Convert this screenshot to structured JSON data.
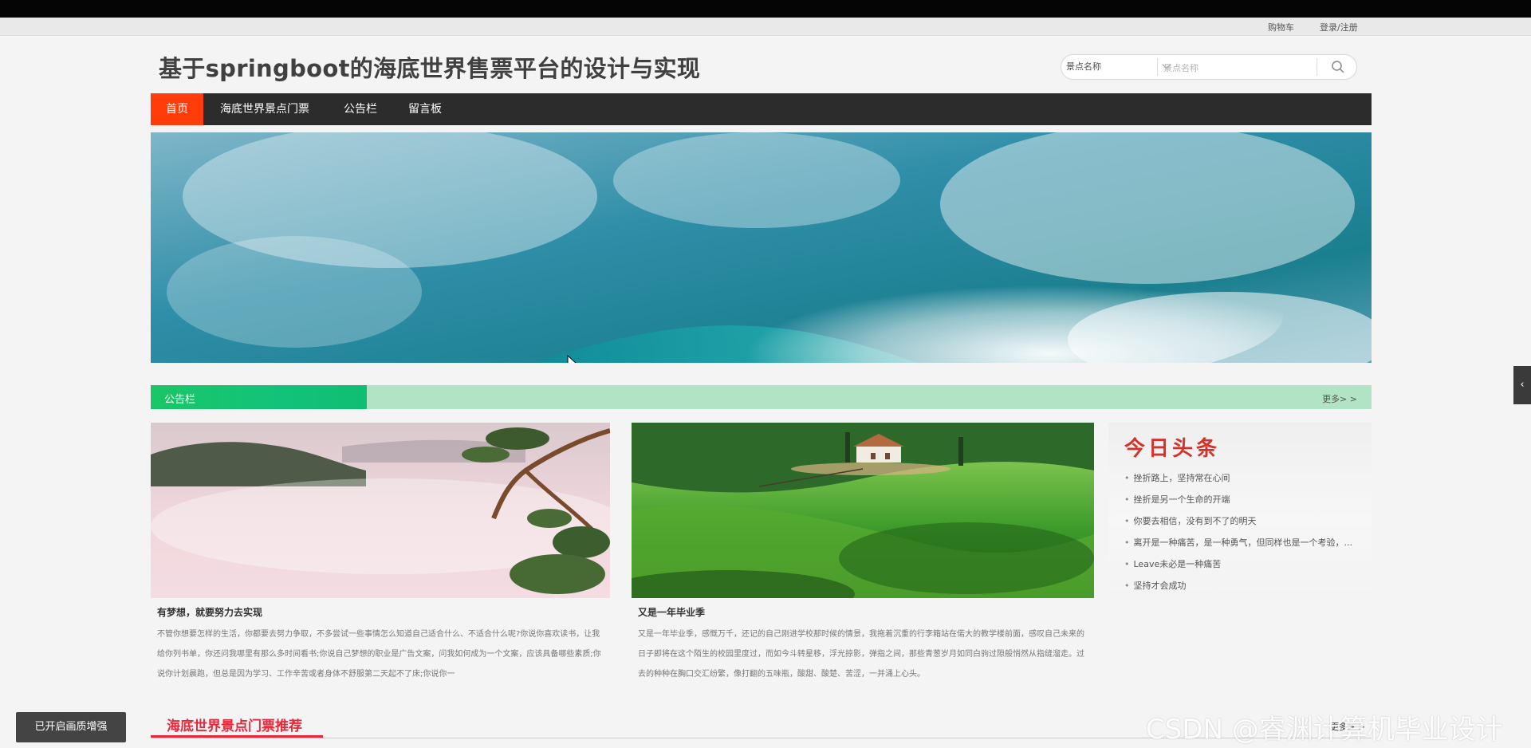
{
  "util_bar": {
    "cart": "购物车",
    "login": "登录/注册"
  },
  "site": {
    "title": "基于springboot的海底世界售票平台的设计与实现"
  },
  "search": {
    "select_value": "景点名称",
    "placeholder": "景点名称"
  },
  "nav": {
    "items": [
      "首页",
      "海底世界景点门票",
      "公告栏",
      "留言板"
    ],
    "active_index": 0
  },
  "notice": {
    "tab": "公告栏",
    "more": "更多> >"
  },
  "cards": [
    {
      "title": "有梦想，就要努力去实现",
      "body": "不管你想要怎样的生活，你都要去努力争取，不多尝试一些事情怎么知道自己适合什么、不适合什么呢?你说你喜欢读书，让我给你列书单，你还问我哪里有那么多时间看书;你说自己梦想的职业是广告文案，问我如何成为一个文案，应该具备哪些素质;你说你计划晨跑，但总是因为学习、工作辛苦或者身体不舒服第二天起不了床;你说你一"
    },
    {
      "title": "又是一年毕业季",
      "body": "又是一年毕业季，感慨万千，还记的自己刚进学校那时候的情景，我拖着沉重的行李箱站在偌大的教学楼前面，感叹自己未来的日子即将在这个陌生的校园里度过，而如今斗转星移，浮光掠影，弹指之间，那些青葱岁月如同白驹过隙般悄然从指缝溜走。过去的种种在胸口交汇纷繁，像打翻的五味瓶，酸甜、酸楚、苦涩，一并涌上心头。"
    }
  ],
  "headline": {
    "title": "今日头条",
    "items": [
      "挫折路上，坚持常在心间",
      "挫折是另一个生命的开端",
      "你要去相信，没有到不了的明天",
      "离开是一种痛苦，是一种勇气，但同样也是一个考验，...",
      "Leave未必是一种痛苦",
      "坚持才会成功"
    ]
  },
  "recommend": {
    "title": "海底世界景点门票推荐",
    "more": "更多> >"
  },
  "overlay": {
    "enhance_button": "已开启画质增强",
    "side_tab": "‹",
    "watermark": "CSDN @睿渊计算机毕业设计"
  },
  "colors": {
    "nav_bg": "#2c2c2c",
    "nav_active": "#ff3c0a",
    "notice_green": "#19c766",
    "notice_bar": "#b1e3c5",
    "recommend_red": "#e8283a",
    "headline_red": "#d4332b"
  }
}
